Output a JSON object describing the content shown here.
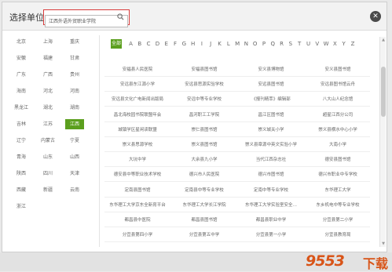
{
  "dialog": {
    "title": "选择单位",
    "search_value": "江西外语外贸职业学院",
    "close_glyph": "✕"
  },
  "provinces": [
    [
      "北京",
      "上海",
      "重庆"
    ],
    [
      "安徽",
      "福建",
      "甘肃"
    ],
    [
      "广东",
      "广西",
      "贵州"
    ],
    [
      "海南",
      "河北",
      "河南"
    ],
    [
      "黑龙江",
      "湖北",
      "湖南"
    ],
    [
      "吉林",
      "江苏",
      "江西"
    ],
    [
      "辽宁",
      "内蒙古",
      "宁夏"
    ],
    [
      "青海",
      "山东",
      "山西"
    ],
    [
      "陕西",
      "四川",
      "天津"
    ],
    [
      "西藏",
      "新疆",
      "云南"
    ],
    [
      "浙江"
    ]
  ],
  "active_province": "江西",
  "alphabet": {
    "all_label": "全部",
    "letters": [
      "A",
      "B",
      "C",
      "D",
      "E",
      "F",
      "G",
      "H",
      "I",
      "J",
      "K",
      "L",
      "M",
      "N",
      "O",
      "P",
      "Q",
      "R",
      "S",
      "T",
      "U",
      "V",
      "W",
      "X",
      "Y",
      "Z"
    ]
  },
  "units": [
    [
      "安福县人民医院",
      "安福县图书馆",
      "安义县博物馆",
      "安义县图书馆"
    ],
    [
      "安远县东江源小学",
      "安远县思源实验学校",
      "安远县图书馆",
      "安远县图书馆云舟"
    ],
    [
      "安远县文化广电新闻出版局",
      "安远中等专业学校",
      "《报刊精萃》编辑部",
      "八大山人纪念馆"
    ],
    [
      "昌北海校园书院联盟年会",
      "昌河职工工学院",
      "昌江区图书馆",
      "超星江西分公司"
    ],
    [
      "城镇学区星闲读联盟",
      "崇仁县图书馆",
      "崇义城关小学",
      "崇义县横水中心小学"
    ],
    [
      "崇义县思源学校",
      "崇义县图书馆",
      "崇义县章源中英文实验小学",
      "大南小学"
    ],
    [
      "大坑中学",
      "大余县九小学",
      "当代江西杂志社",
      "德安县图书馆"
    ],
    [
      "德安县中等职业技术学校",
      "德兴市人民医院",
      "德兴市图书馆",
      "德兴市职业中专学校"
    ],
    [
      "定南县图书馆",
      "定南县中等专业学校",
      "定南中等专业学校",
      "东华理工大学"
    ],
    [
      "东华理工大学京东全新育平台",
      "东华理工大学长江学院",
      "东华理工大学实验室安全…",
      "东乡机电中等专业学校"
    ],
    [
      "都昌县中医院",
      "都昌县图书馆",
      "都昌县职业中学",
      "分宜县第二小学"
    ],
    [
      "分宜县第四小学",
      "分宜县第五中学",
      "分宜县第一小学",
      "分宜县教育局"
    ]
  ],
  "watermark": {
    "number": "9553",
    "suffix": "下载"
  }
}
